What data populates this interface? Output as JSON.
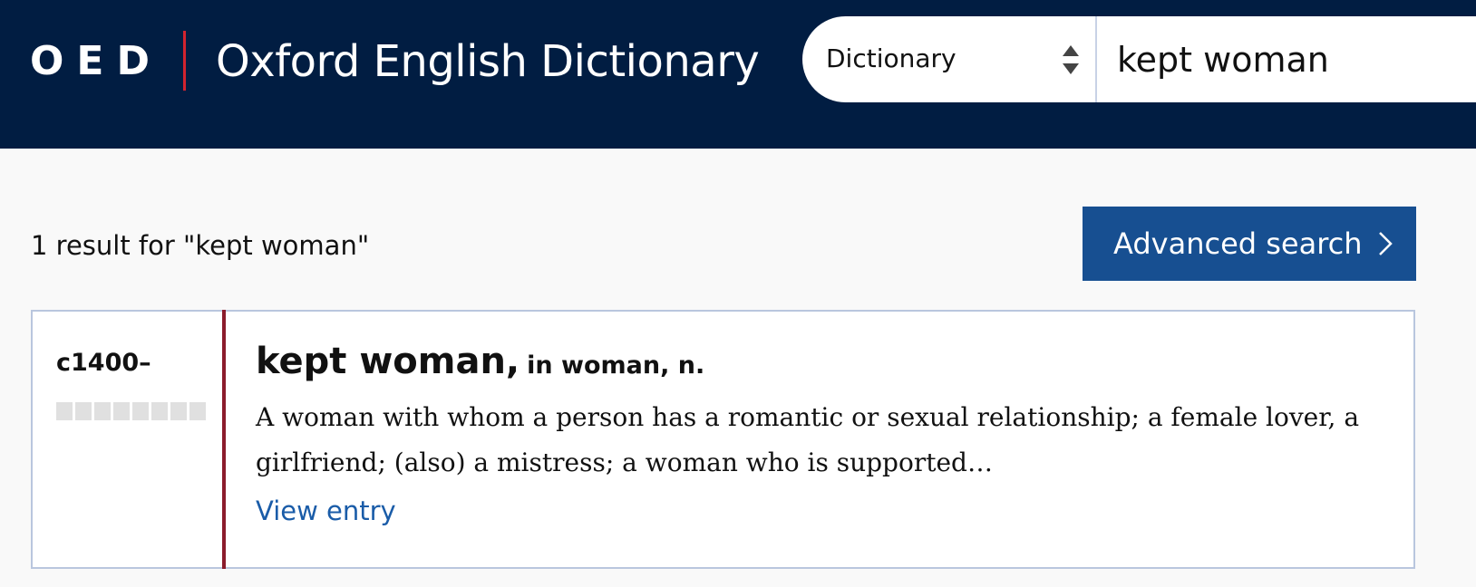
{
  "header": {
    "logo_abbr": "OED",
    "logo_title": "Oxford English Dictionary",
    "background_color": "#011d42",
    "divider_color": "#d3242f"
  },
  "search": {
    "scope_selected": "Dictionary",
    "query_value": "kept woman",
    "scope_icon": "sort-arrows-icon"
  },
  "results": {
    "count_text": "1 result for \"kept woman\"",
    "advanced_search_label": "Advanced search",
    "advanced_search_icon": "chevron-right-icon",
    "button_color": "#174f91",
    "items": [
      {
        "date": "c1400–",
        "headword": "kept woman,",
        "headword_context": "in woman, n.",
        "definition": "A woman with whom a person has a romantic or sexual relationship; a female lover, a girlfriend; (also) a mistress; a woman who is supported…",
        "view_link": "View entry",
        "accent_color": "#8b1c2c",
        "link_color": "#1a5ca8"
      }
    ]
  }
}
